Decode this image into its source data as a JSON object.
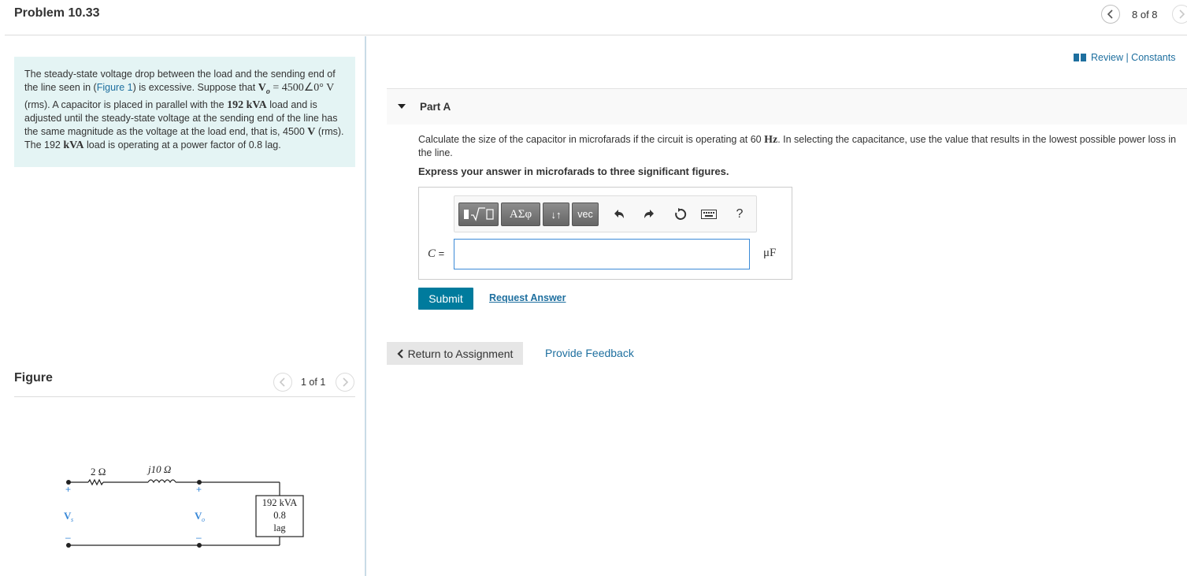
{
  "header": {
    "title": "Problem 10.33",
    "prev_icon": "chevron-left-icon",
    "next_icon": "chevron-right-icon",
    "count": "8 of 8"
  },
  "problem": {
    "t1": "The steady-state voltage drop between the load and the sending end of the line seen in (",
    "figure_link": "Figure 1",
    "t2": ") is excessive. Suppose that ",
    "vo_symbol": "V",
    "vo_sub": "o",
    "vo_value": " = 4500∠0° V",
    "t3": " (rms). A capacitor is placed in parallel with the ",
    "load_kva": "192 kVA",
    "t4": " load and is adjusted until the steady-state voltage at the sending end of the line has the same magnitude as the voltage at the load end, that is, 4500 ",
    "volt_unit": "V",
    "t5": " (rms). The 192 ",
    "kva_unit": "kVA",
    "t6": " load is operating at a power factor of 0.8 lag."
  },
  "figure": {
    "title": "Figure",
    "count": "1 of 1",
    "circuit": {
      "r_label": "2 Ω",
      "x_label": "j10 Ω",
      "vs_label": "V",
      "vs_sub": "s",
      "vo_label": "V",
      "vo_sub": "o",
      "plus": "+",
      "minus": "–",
      "load_line1": "192 kVA",
      "load_line2": "0.8",
      "load_line3": "lag"
    }
  },
  "review": {
    "icon": "book-icon",
    "text": "Review | Constants"
  },
  "part_a": {
    "title": "Part A",
    "q1": "Calculate the size of the capacitor in microfarads if the circuit is operating at 60 ",
    "hz": "Hz",
    "q2": ". In selecting the capacitance, use the value that results in the lowest possible power loss in the line.",
    "instruction": "Express your answer in microfarads to three significant figures.",
    "toolbar": {
      "templates_icon": "templates-sqrt-icon",
      "greek": "ΑΣφ",
      "sort": "↓↑",
      "vec": "vec",
      "undo_icon": "undo-icon",
      "redo_icon": "redo-icon",
      "reset_icon": "reset-icon",
      "keyboard_icon": "keyboard-icon",
      "help": "?"
    },
    "var_label": "C",
    "equals": " =",
    "input_value": "",
    "unit": "μF",
    "submit": "Submit",
    "request_answer": "Request Answer"
  },
  "footer": {
    "return": "Return to Assignment",
    "feedback": "Provide Feedback"
  },
  "colors": {
    "accent": "#007b9d",
    "link": "#1e6f9f",
    "problem_bg": "#e4f4f4",
    "input_border": "#3b8ad8"
  }
}
